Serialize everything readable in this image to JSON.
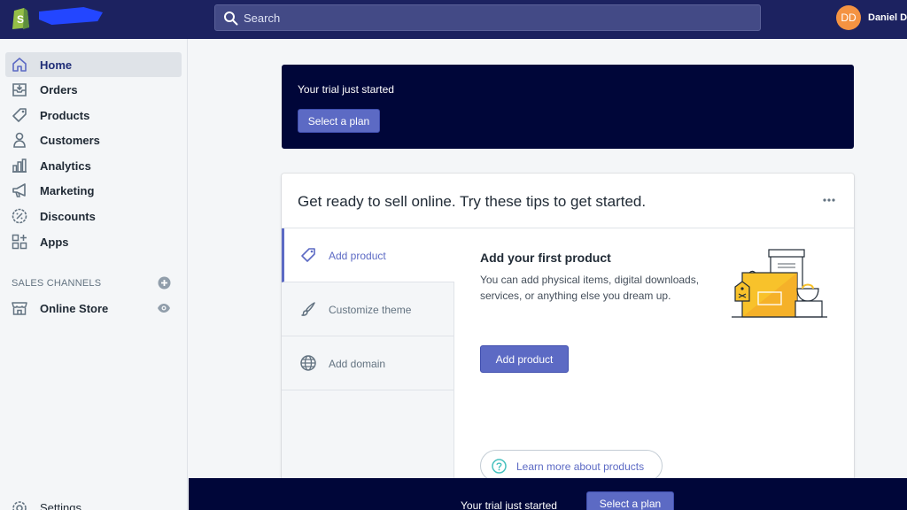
{
  "topbar": {
    "search_label": "Search",
    "avatar_initials": "DD",
    "user_name": "Daniel D"
  },
  "sidebar": {
    "items": [
      {
        "label": "Home",
        "icon": "home-icon",
        "active": true
      },
      {
        "label": "Orders",
        "icon": "orders-icon"
      },
      {
        "label": "Products",
        "icon": "tag-icon"
      },
      {
        "label": "Customers",
        "icon": "person-icon"
      },
      {
        "label": "Analytics",
        "icon": "bar-chart-icon"
      },
      {
        "label": "Marketing",
        "icon": "megaphone-icon"
      },
      {
        "label": "Discounts",
        "icon": "discount-icon"
      },
      {
        "label": "Apps",
        "icon": "apps-icon"
      }
    ],
    "sales_channels_heading": "SALES CHANNELS",
    "online_store_label": "Online Store",
    "settings_label": "Settings"
  },
  "trial": {
    "text": "Your trial just started",
    "button_label": "Select a plan"
  },
  "tips": {
    "title": "Get ready to sell online. Try these tips to get started.",
    "tabs": [
      {
        "label": "Add product",
        "icon": "tag-icon",
        "active": true
      },
      {
        "label": "Customize theme",
        "icon": "brush-icon"
      },
      {
        "label": "Add domain",
        "icon": "globe-icon"
      }
    ],
    "panel_title": "Add your first product",
    "panel_desc": "You can add physical items, digital downloads, services, or anything else you dream up.",
    "button_label": "Add product",
    "learn_more": "Learn more about products"
  },
  "bottom_bar": {
    "text": "Your trial just started",
    "button_label": "Select a plan"
  },
  "colors": {
    "topbar": "#1c2260",
    "trial_bg": "#000639",
    "accent": "#5c6ac4",
    "illustration_yellow": "#f8c22b"
  }
}
